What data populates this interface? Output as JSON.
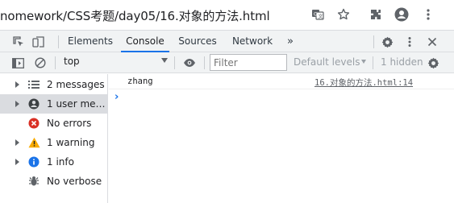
{
  "address_bar": {
    "url_text": "nomework/CSS考题/day05/16.对象的方法.html",
    "icons": [
      "translate-icon",
      "star-icon",
      "extensions-icon",
      "profile-icon",
      "more-vert-icon"
    ]
  },
  "devtools_tabs": {
    "items": [
      "Elements",
      "Console",
      "Sources",
      "Network"
    ],
    "active": "Console",
    "more": "»",
    "icons": [
      "inspect-icon",
      "device-toolbar-icon",
      "settings-icon",
      "more-vert-icon",
      "close-icon"
    ]
  },
  "console_toolbar": {
    "context": "top",
    "filter_placeholder": "Filter",
    "levels": "Default levels",
    "hidden_count": "1 hidden",
    "icons": [
      "sidebar-toggle-icon",
      "clear-icon",
      "eye-icon",
      "settings-icon"
    ]
  },
  "sidebar": {
    "items": [
      {
        "label": "2 messages",
        "icon": "list-icon",
        "expandable": true,
        "selected": false
      },
      {
        "label": "1 user mess...",
        "icon": "user-icon",
        "expandable": true,
        "selected": true
      },
      {
        "label": "No errors",
        "icon": "error-icon",
        "expandable": false,
        "selected": false
      },
      {
        "label": "1 warning",
        "icon": "warning-icon",
        "expandable": true,
        "selected": false
      },
      {
        "label": "1 info",
        "icon": "info-icon",
        "expandable": true,
        "selected": false
      },
      {
        "label": "No verbose",
        "icon": "bug-icon",
        "expandable": false,
        "selected": false
      }
    ]
  },
  "console": {
    "messages": [
      {
        "text": "zhang",
        "source": "16.对象的方法.html:14"
      }
    ],
    "prompt": "›"
  },
  "colors": {
    "accent": "#1a73e8",
    "error": "#d93025",
    "warning": "#f9ab00",
    "info": "#1a73e8",
    "toolbar_bg": "#f1f3f4"
  }
}
